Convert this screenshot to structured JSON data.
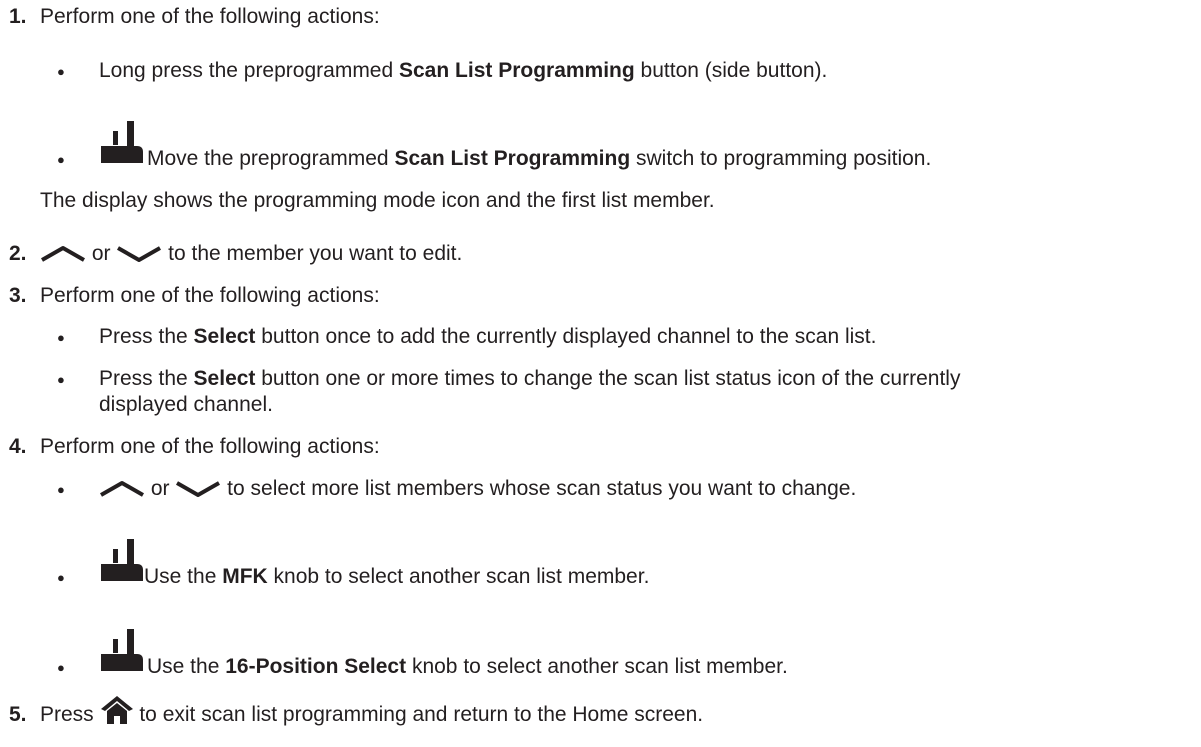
{
  "steps": [
    {
      "number": "1.",
      "text": "Perform one of the following actions:",
      "bullets": [
        {
          "pre": "Long press the preprogrammed ",
          "bold": "Scan List Programming",
          "post": " button (side button)."
        },
        {
          "icon": "radio-model-icon",
          "pre": " Move the preprogrammed ",
          "bold": "Scan List Programming",
          "post": " switch to programming position."
        }
      ],
      "note": "The display shows the programming mode icon and the first list member."
    },
    {
      "number": "2.",
      "icons": [
        "caret-up-icon",
        "caret-down-icon"
      ],
      "or_text": " or ",
      "post": " to the member you want to edit."
    },
    {
      "number": "3.",
      "text": "Perform one of the following actions:",
      "bullets": [
        {
          "pre": "Press the ",
          "bold": "Select",
          "post": " button once to add the currently displayed channel to the scan list."
        },
        {
          "pre": "Press the ",
          "bold": "Select",
          "post": " button one or more times to change the scan list status icon of the currently",
          "post2": "displayed channel."
        }
      ]
    },
    {
      "number": "4.",
      "text": "Perform one of the following actions:",
      "bullets": [
        {
          "icons": [
            "caret-up-icon",
            "caret-down-icon"
          ],
          "or_text": " or ",
          "post": " to select more list members whose scan status you want to change."
        },
        {
          "icon": "radio-model-icon",
          "pre": " Use the ",
          "bold": "MFK",
          "post": " knob to select another scan list member."
        },
        {
          "icon": "radio-model-icon",
          "pre": " Use the ",
          "bold": "16-Position Select",
          "post": " knob to select another scan list member."
        }
      ]
    },
    {
      "number": "5.",
      "pre": "Press ",
      "icon": "home-icon",
      "post": " to exit scan list programming and return to the Home screen."
    }
  ],
  "bullet_char": "●"
}
